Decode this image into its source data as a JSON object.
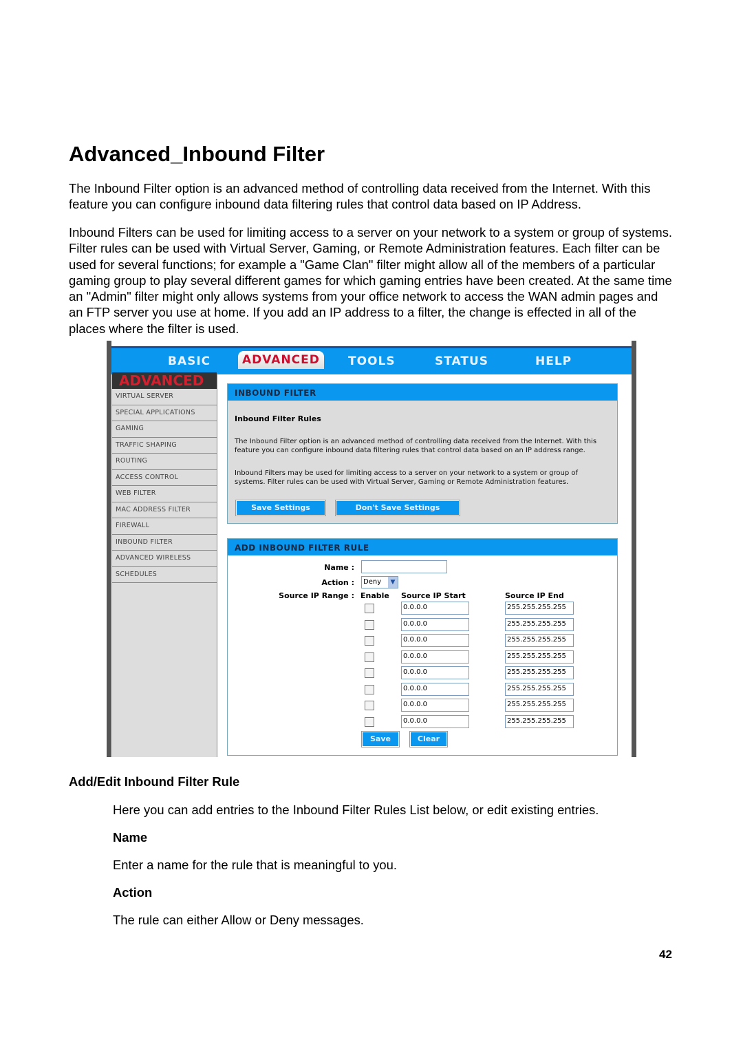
{
  "title": "Advanced_Inbound Filter",
  "intro": [
    "The Inbound Filter option is an advanced method of controlling data received from the Internet. With this feature you can configure inbound data filtering rules that control data based on IP Address.",
    "Inbound Filters can be used for limiting access to a server on your network to a system or group of systems. Filter rules can be used with Virtual Server, Gaming, or Remote Administration features. Each filter can be used for several functions; for example a \"Game Clan\" filter might allow all of the members of a particular gaming group to play several different games for which gaming entries have been created. At the same time an \"Admin\" filter might only allows systems from your office network to access the WAN admin pages and an FTP server you use at home. If you add an IP address to a filter, the change is effected in all of the places where the filter is used."
  ],
  "ui": {
    "nav": [
      "BASIC",
      "ADVANCED",
      "TOOLS",
      "STATUS",
      "HELP"
    ],
    "active_tab": "ADVANCED",
    "sidebar_title": "ADVANCED",
    "sidebar": [
      "VIRTUAL SERVER",
      "SPECIAL APPLICATIONS",
      "GAMING",
      "TRAFFIC SHAPING",
      "ROUTING",
      "ACCESS CONTROL",
      "WEB FILTER",
      "MAC ADDRESS FILTER",
      "FIREWALL",
      "INBOUND FILTER",
      "ADVANCED WIRELESS",
      "SCHEDULES"
    ],
    "panel1": {
      "header": "INBOUND FILTER",
      "subtitle": "Inbound Filter Rules",
      "text1": "The Inbound Filter option is an advanced method of controlling data received from the Internet. With this feature you can configure inbound data filtering rules that control data based on an IP address range.",
      "text2": "Inbound Filters may be used for limiting access to a server on your network to a system or group of systems. Filter rules can be used with Virtual Server, Gaming or Remote Administration features.",
      "save": "Save Settings",
      "dont_save": "Don't Save Settings"
    },
    "panel2": {
      "header": "ADD INBOUND FILTER RULE",
      "name_label": "Name :",
      "name_value": "",
      "action_label": "Action :",
      "action_value": "Deny",
      "range_label": "Source IP Range :",
      "col_enable": "Enable",
      "col_start": "Source IP Start",
      "col_end": "Source IP End",
      "rows": [
        {
          "start": "0.0.0.0",
          "end": "255.255.255.255",
          "enabled": false
        },
        {
          "start": "0.0.0.0",
          "end": "255.255.255.255",
          "enabled": false
        },
        {
          "start": "0.0.0.0",
          "end": "255.255.255.255",
          "enabled": false
        },
        {
          "start": "0.0.0.0",
          "end": "255.255.255.255",
          "enabled": false
        },
        {
          "start": "0.0.0.0",
          "end": "255.255.255.255",
          "enabled": false
        },
        {
          "start": "0.0.0.0",
          "end": "255.255.255.255",
          "enabled": false
        },
        {
          "start": "0.0.0.0",
          "end": "255.255.255.255",
          "enabled": false
        },
        {
          "start": "0.0.0.0",
          "end": "255.255.255.255",
          "enabled": false
        }
      ],
      "save": "Save",
      "clear": "Clear"
    },
    "accent": "#0a97f0"
  },
  "section": {
    "heading": "Add/Edit Inbound Filter Rule",
    "text": "Here you can add entries to the Inbound Filter Rules List below, or edit existing entries.",
    "name_heading": "Name",
    "name_text": "Enter a name for the rule that is meaningful to you.",
    "action_heading": "Action",
    "action_text": "The rule can either Allow or Deny messages."
  },
  "page_number": "42"
}
